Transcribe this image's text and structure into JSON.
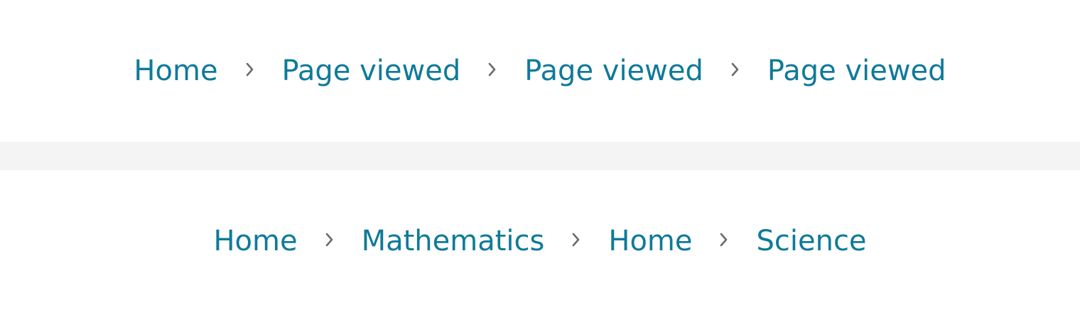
{
  "colors": {
    "link": "#0f7a99",
    "separator": "#6b6b6b",
    "divider_band": "#f4f4f4",
    "background": "#ffffff"
  },
  "icons": {
    "separator": "chevron-right-icon"
  },
  "breadcrumbs": [
    {
      "items": [
        {
          "label": "Home"
        },
        {
          "label": "Page viewed"
        },
        {
          "label": "Page viewed"
        },
        {
          "label": "Page viewed"
        }
      ]
    },
    {
      "items": [
        {
          "label": "Home"
        },
        {
          "label": "Mathematics"
        },
        {
          "label": "Home"
        },
        {
          "label": "Science"
        }
      ]
    }
  ]
}
